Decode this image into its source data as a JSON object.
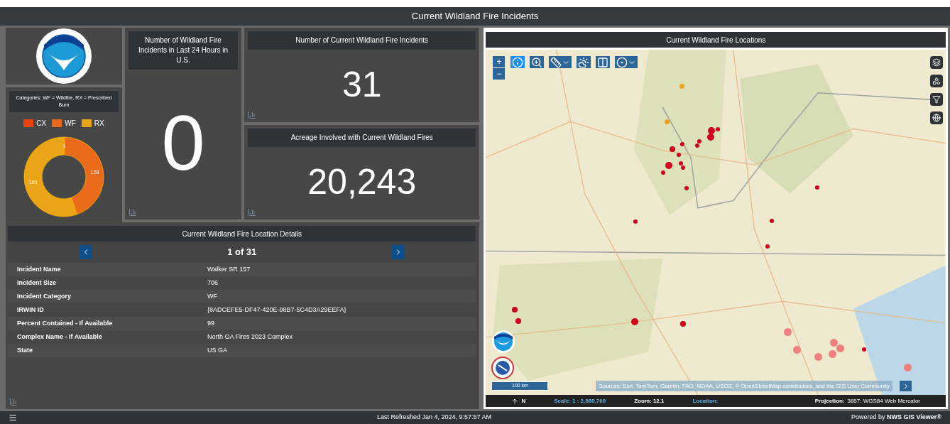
{
  "header": {
    "title": "Current Wildland Fire Incidents"
  },
  "category_panel": {
    "title": "Categories: WF = Wildfire, RX = Prescribed Burn",
    "chart_data": {
      "type": "donut",
      "categories": [
        "CX",
        "WF",
        "RX"
      ],
      "values": [
        1,
        128,
        160
      ],
      "colors": [
        "#e8420e",
        "#ea6a1c",
        "#e9a417"
      ],
      "legend": true,
      "data_labels": true
    }
  },
  "indicators": [
    {
      "title": "Number of Wildland Fire Incidents in Last 24 Hours in U.S.",
      "value": "0"
    },
    {
      "title": "Number of Current Wildland Fire Incidents",
      "value": "31"
    },
    {
      "title": "Acreage Involved with Current Wildland Fires",
      "value": "20,243"
    }
  ],
  "details": {
    "title": "Current Wildland Fire Location Details",
    "pager": "1 of 31",
    "rows": [
      {
        "label": "Incident Name",
        "value": "Walker SR 157"
      },
      {
        "label": "Incident Size",
        "value": "706"
      },
      {
        "label": "Incident Category",
        "value": "WF"
      },
      {
        "label": "IRWIN ID",
        "value": "{8ADCEFE5-DF47-420E-98B7-5C4D3A29EEFA}"
      },
      {
        "label": "Percent Contained - If Available",
        "value": "99"
      },
      {
        "label": "Complex Name - If Available",
        "value": "North GA Fires 2023 Complex"
      },
      {
        "label": "State",
        "value": "US GA"
      }
    ]
  },
  "map": {
    "title": "Current Wildland Fire Locations",
    "zoom_buttons": [
      "+",
      "−"
    ],
    "toolbar": [
      {
        "kind": "info",
        "selected": true
      },
      {
        "kind": "zoom",
        "selected": false
      },
      {
        "kind": "measure",
        "selected": false
      },
      {
        "kind": "weather",
        "selected": false
      },
      {
        "kind": "swipe",
        "selected": false
      },
      {
        "kind": "target",
        "selected": false
      }
    ],
    "scale_bar": "100 km",
    "attribution": "Sources: Esri, TomTom, Garmin, FAO, NOAA, USGS, © OpenStreetMap contributors, and the GIS User Community",
    "status": {
      "north": "N",
      "scale": "Scale: 1 : 2,580,760",
      "zoom": "Zoom: 12.1",
      "location": "Location:",
      "projection_label": "Projection:",
      "projection": "3857: WGS84 Web Mercator"
    }
  },
  "footer": {
    "refreshed": "Last Refreshed Jan 4, 2024, 9:57:57 AM",
    "powered": "Powered by **NWS GIS Viewer®**"
  }
}
